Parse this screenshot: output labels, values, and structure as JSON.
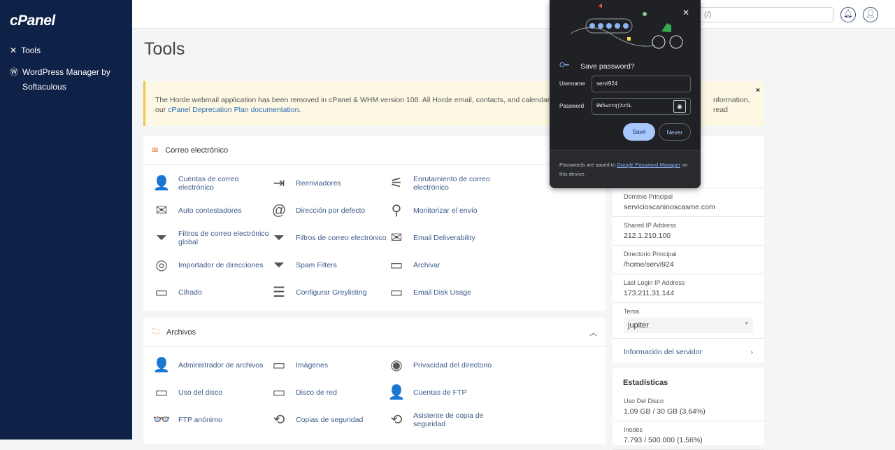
{
  "sidebar": {
    "logo": "cPanel",
    "items": [
      {
        "label": "Tools"
      },
      {
        "label": "WordPress Manager by Softaculous"
      }
    ]
  },
  "topbar": {
    "search_placeholder": "(/)"
  },
  "page_title": "Tools",
  "notice": {
    "text": "The Horde webmail application has been removed in cPanel & WHM version 108. All Horde email, contacts, and calendars will be d",
    "text_tail": "nformation, read",
    "text2_prefix": "our ",
    "link": "cPanel Deprecation Plan documentation",
    "text2_suffix": ".",
    "close": "×"
  },
  "email": {
    "title": "Correo electrónico",
    "tools": [
      "Cuentas de correo electrónico",
      "Reenviadores",
      "Enrutamiento de correo electrónico",
      "Auto contestadores",
      "Dirección por defecto",
      "Monitorizar el envío",
      "Filtros de correo electrónico global",
      "Filtros de correo electrónico",
      "Email Deliverability",
      "Importador de direcciones",
      "Spam Filters",
      "Archivar",
      "Cifrado",
      "Configurar Greylisting",
      "Email Disk Usage"
    ]
  },
  "files": {
    "title": "Archivos",
    "tools": [
      "Administrador de archivos",
      "Imágenes",
      "Privacidad del directorio",
      "Uso del disco",
      "Disco de red",
      "Cuentas de FTP",
      "FTP anónimo",
      "Copias de seguridad",
      "Asistente de copia de seguridad"
    ]
  },
  "general": {
    "rows": [
      {
        "label": "Dominio Principal",
        "value": "servicioscaninoscasme.com"
      },
      {
        "label": "Shared IP Address",
        "value": "212.1.210.100"
      },
      {
        "label": "Directorio Principal",
        "value": "/home/servi924"
      },
      {
        "label": "Last Login IP Address",
        "value": "173.211.31.144"
      }
    ],
    "theme_label": "Tema",
    "theme_value": "jupiter",
    "server_info": "Información del servidor"
  },
  "stats": {
    "title": "Estadísticas",
    "rows": [
      {
        "label": "Uso Del Disco",
        "value": "1,09 GB / 30 GB   (3,64%)"
      },
      {
        "label": "Inodes",
        "value": "7.793 / 500.000   (1,56%)"
      }
    ]
  },
  "password_popup": {
    "title": "Save password?",
    "username_label": "Username",
    "username": "servi924",
    "password_label": "Password",
    "password": "BW5wstqjXz5L",
    "save": "Save",
    "never": "Never",
    "footer_prefix": "Passwords are saved to ",
    "footer_link": "Google Password Manager",
    "footer_suffix": " on this device."
  }
}
